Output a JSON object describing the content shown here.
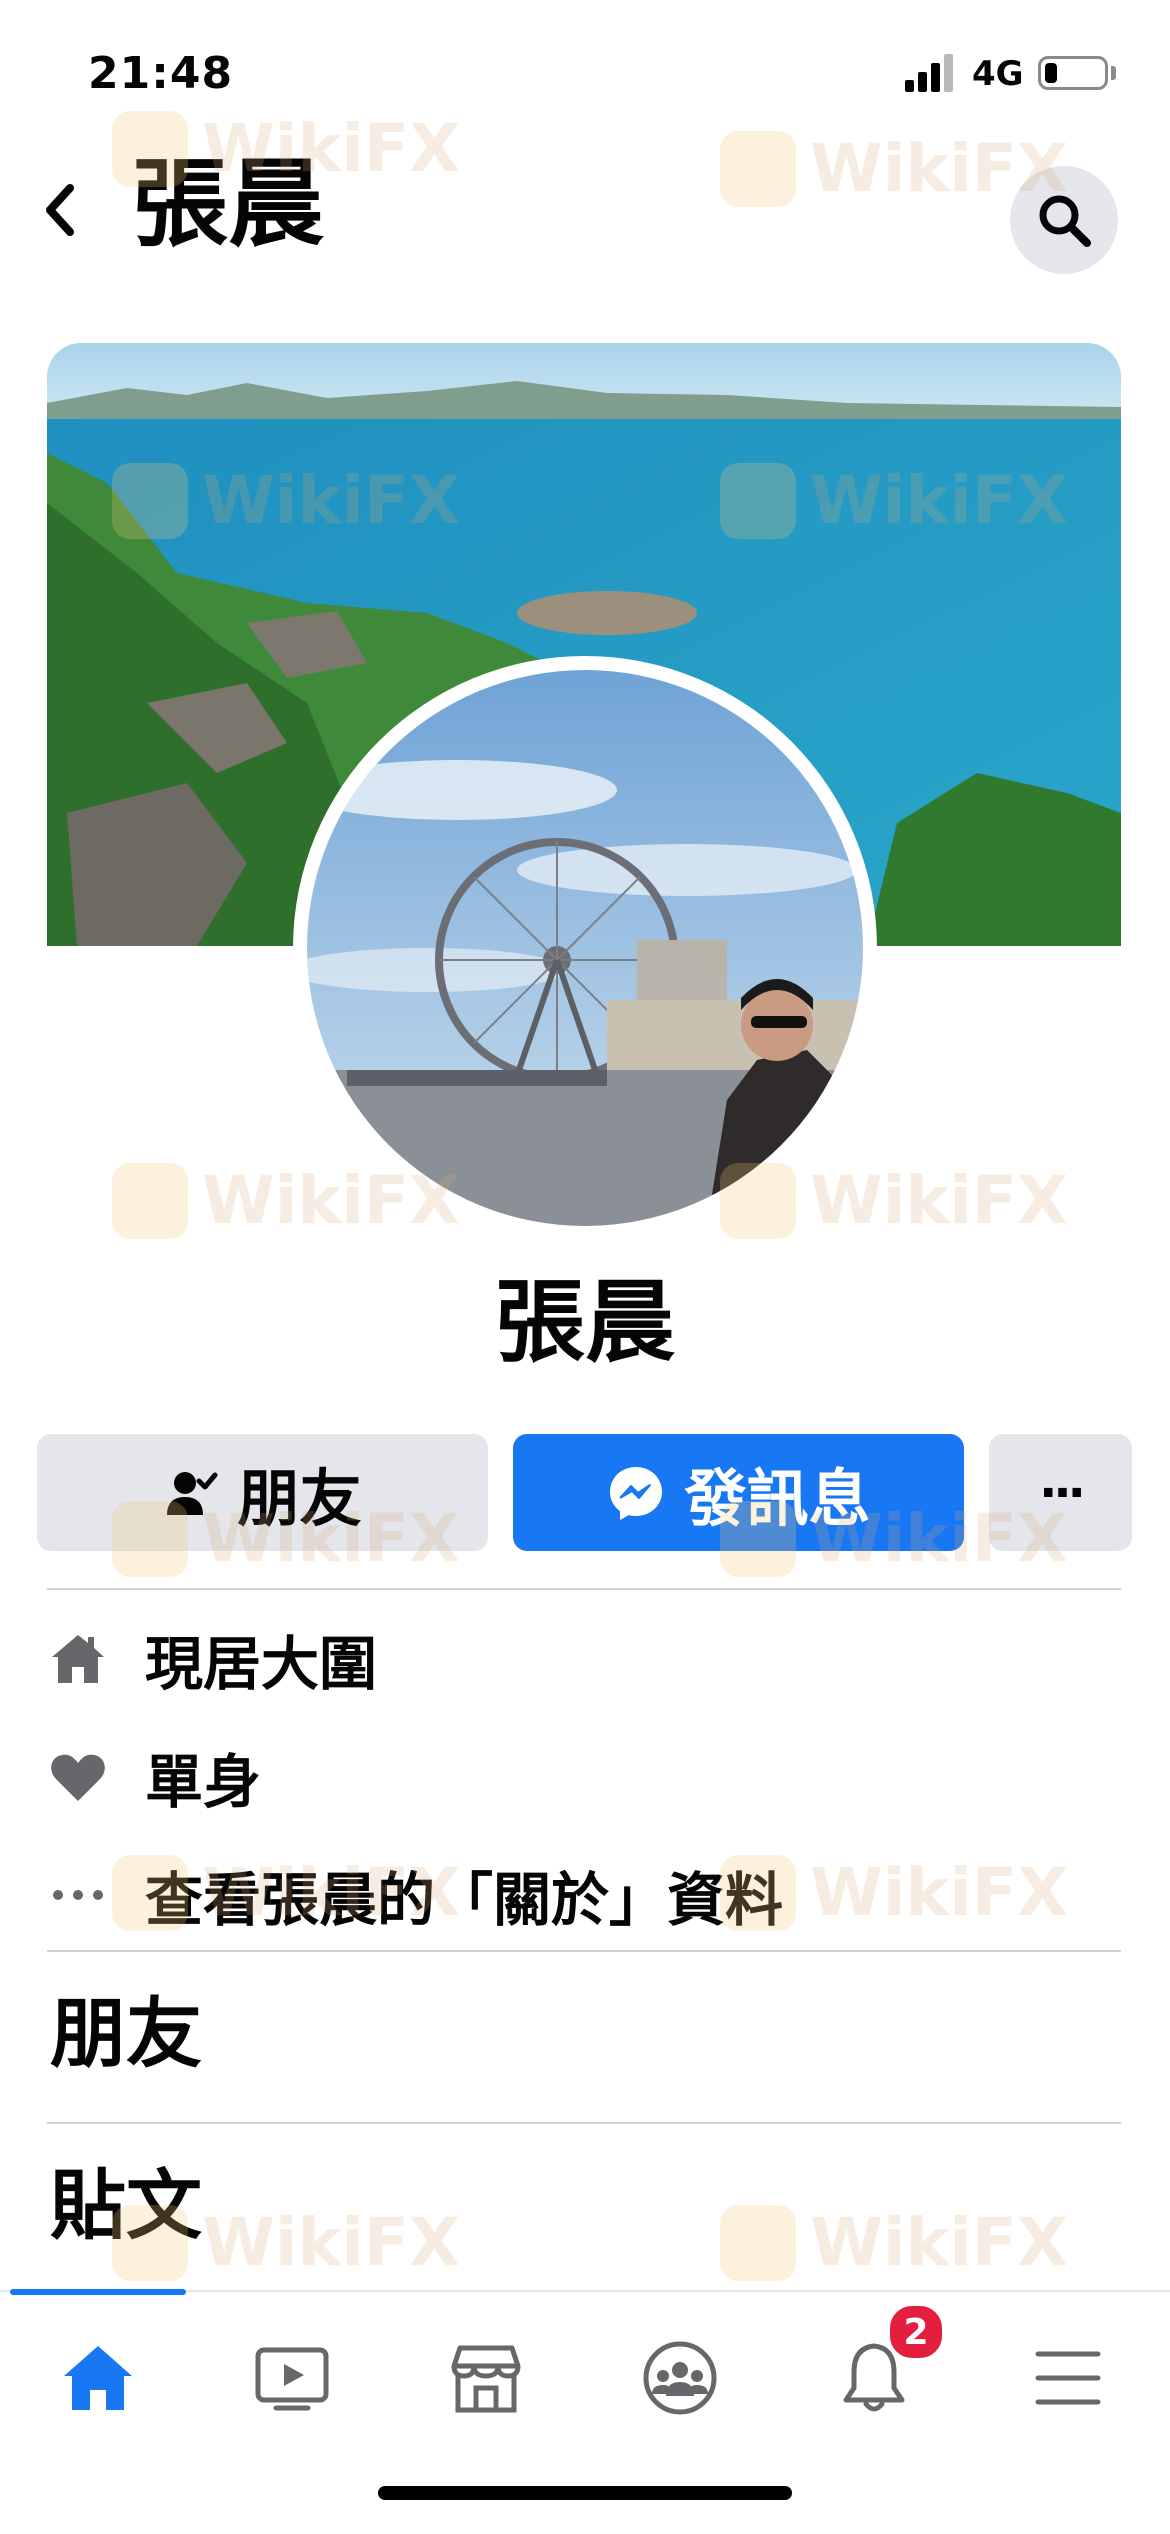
{
  "status_bar": {
    "time": "21:48",
    "network": "4G"
  },
  "header": {
    "title": "張晨"
  },
  "profile": {
    "name": "張晨"
  },
  "actions": {
    "friends_label": "朋友",
    "message_label": "發訊息",
    "more_label": "···"
  },
  "info": {
    "lives_in": "現居大圍",
    "relationship": "單身",
    "about": "查看張晨的「關於」資料"
  },
  "sections": {
    "friends": "朋友",
    "posts": "貼文"
  },
  "tabbar": {
    "notifications_badge": "2"
  },
  "watermark": "WikiFX",
  "colors": {
    "accent": "#1877f2",
    "button_gray": "#e4e6eb",
    "badge": "#e41e3f"
  },
  "icons": [
    "chevron-left-icon",
    "search-icon",
    "friend-check-icon",
    "messenger-icon",
    "home-icon",
    "heart-icon",
    "more-dots-icon",
    "home-tab-icon",
    "video-tab-icon",
    "marketplace-tab-icon",
    "groups-tab-icon",
    "bell-tab-icon",
    "menu-tab-icon"
  ]
}
